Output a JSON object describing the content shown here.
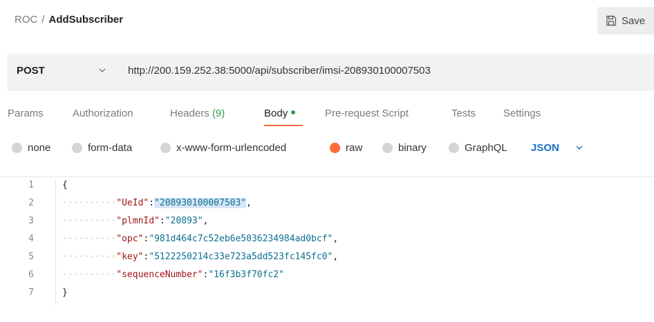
{
  "breadcrumb": {
    "root": "ROC",
    "separator": "/",
    "current": "AddSubscriber"
  },
  "save_button": {
    "label": "Save",
    "icon": "save-icon"
  },
  "request": {
    "method": "POST",
    "url": "http://200.159.252.38:5000/api/subscriber/imsi-208930100007503"
  },
  "tabs": {
    "params": "Params",
    "authorization": "Authorization",
    "headers_label": "Headers",
    "headers_count": "(9)",
    "body": "Body",
    "prerequest": "Pre-request Script",
    "tests": "Tests",
    "settings": "Settings",
    "active": "Body"
  },
  "body_options": {
    "none": "none",
    "form_data": "form-data",
    "urlencoded": "x-www-form-urlencoded",
    "raw": "raw",
    "binary": "binary",
    "graphql": "GraphQL",
    "selected": "raw",
    "format": "JSON"
  },
  "editor": {
    "line_numbers": [
      "1",
      "2",
      "3",
      "4",
      "5",
      "6",
      "7"
    ],
    "open_brace": "{",
    "close_brace": "}",
    "fields": [
      {
        "key": "\"UeId\"",
        "value": "\"208930100007503\"",
        "sep": ":",
        "trail": ","
      },
      {
        "key": "\"plmnId\"",
        "value": "\"20893\"",
        "sep": ":",
        "trail": ","
      },
      {
        "key": "\"opc\"",
        "value": "\"981d464c7c52eb6e5036234984ad0bcf\"",
        "sep": ":",
        "trail": ","
      },
      {
        "key": "\"key\"",
        "value": "\"5122250214c33e723a5dd523fc145fc0\"",
        "sep": ":",
        "trail": ","
      },
      {
        "key": "\"sequenceNumber\"",
        "value": "\"16f3b3f70fc2\"",
        "sep": ":",
        "trail": ""
      }
    ],
    "indent_dots": "··········"
  },
  "colors": {
    "accent": "#ff6c37",
    "json_blue": "#1c6fc9",
    "headers_count_green": "#2e9e4f",
    "json_key": "#a31515",
    "json_string": "#0b6e8f"
  }
}
